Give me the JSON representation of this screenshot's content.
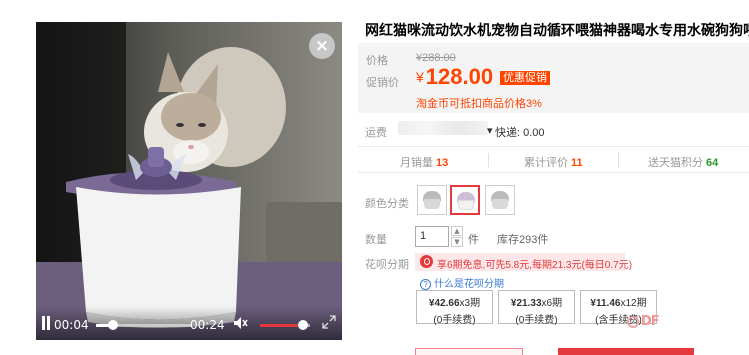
{
  "video": {
    "current_time": "00:04",
    "duration": "00:24",
    "progress": 0.18,
    "volume": 0.85
  },
  "close_label": "×",
  "product": {
    "title": "网红猫咪流动饮水机宠物自动循环喂猫神器喝水专用水碗狗狗喂水器",
    "price_label": "价格",
    "original_price": "¥288.00",
    "promo_label": "促销价",
    "currency": "¥",
    "promo_price": "128.00",
    "promo_tag": "优惠促销",
    "coin_note": "淘金币可抵扣商品价格3%",
    "shipping_label": "运费",
    "shipping_value": "快递: 0.00",
    "stats": [
      {
        "label": "月销量",
        "value": "13"
      },
      {
        "label": "累计评价",
        "value": "11"
      },
      {
        "label": "送天猫积分",
        "value": "64"
      }
    ],
    "color_label": "颜色分类",
    "qty_label": "数量",
    "qty_value": "1",
    "qty_unit": "件",
    "stock": "库存293件",
    "huabei_label": "花呗分期",
    "huabei_banner": "享6期免息,可先5.8元,每期21.3元(每日0.7元)",
    "huabei_what": "什么是花呗分期",
    "plans": [
      {
        "amount": "¥42.66",
        "periods": "x3期",
        "fee": "(0手续费)"
      },
      {
        "amount": "¥21.33",
        "periods": "x6期",
        "fee": "(0手续费)"
      },
      {
        "amount": "¥11.46",
        "periods": "x12期",
        "fee": "(含手续费)"
      }
    ]
  },
  "watermark": "DF",
  "colors": {
    "accent": "#ff4400",
    "brand_red": "#e4393c",
    "green": "#2a9a2a"
  }
}
